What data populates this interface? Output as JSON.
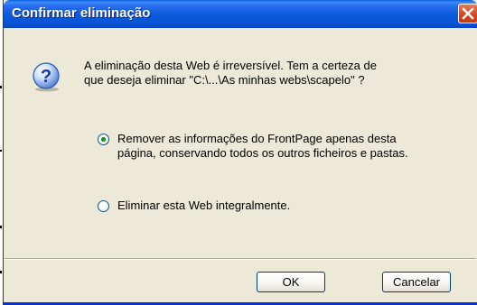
{
  "dialog": {
    "title": "Confirmar eliminação",
    "message_line1": "A eliminação desta Web é irreversível. Tem a certeza de",
    "message_line2": "que deseja eliminar \"C:\\...\\As minhas webs\\scapelo\" ?",
    "icon": "question-icon"
  },
  "options": [
    {
      "line1": "Remover as informações do FrontPage apenas desta",
      "line2": "página, conservando todos os outros ficheiros e pastas.",
      "selected": true
    },
    {
      "line1": "Eliminar esta Web integralmente.",
      "selected": false
    }
  ],
  "buttons": {
    "ok": "OK",
    "cancel": "Cancelar"
  },
  "colors": {
    "titlebar": "#0a53d4",
    "dialog_background": "#ece9d8",
    "close_button": "#d3451f"
  }
}
